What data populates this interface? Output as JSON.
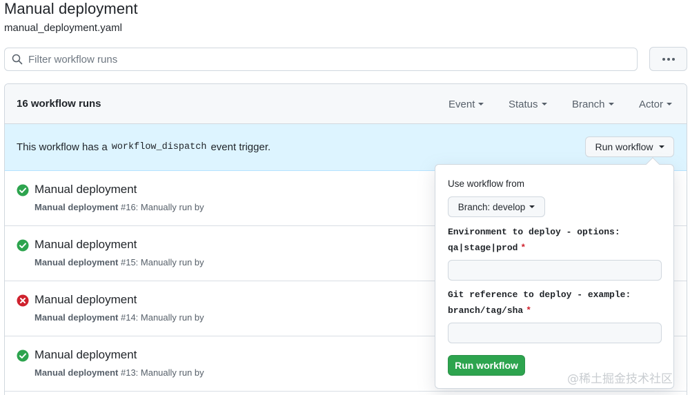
{
  "page": {
    "title": "Manual deployment",
    "subtitle": "manual_deployment.yaml"
  },
  "search": {
    "placeholder": "Filter workflow runs",
    "value": ""
  },
  "runs_header": {
    "count_label": "16 workflow runs",
    "filters": [
      "Event",
      "Status",
      "Branch",
      "Actor"
    ]
  },
  "dispatch_banner": {
    "text_before": "This workflow has a",
    "code": "workflow_dispatch",
    "text_after": "event trigger.",
    "button_label": "Run workflow"
  },
  "runs": [
    {
      "title": "Manual deployment",
      "workflow": "Manual deployment",
      "meta": "#16: Manually run by",
      "status": "success"
    },
    {
      "title": "Manual deployment",
      "workflow": "Manual deployment",
      "meta": "#15: Manually run by",
      "status": "success"
    },
    {
      "title": "Manual deployment",
      "workflow": "Manual deployment",
      "meta": "#14: Manually run by",
      "status": "failure"
    },
    {
      "title": "Manual deployment",
      "workflow": "Manual deployment",
      "meta": "#13: Manually run by",
      "status": "success"
    }
  ],
  "popover": {
    "use_from_label": "Use workflow from",
    "branch_label": "Branch: develop",
    "inputs": [
      {
        "label_line1": "Environment to deploy - options:",
        "label_line2": "qa|stage|prod",
        "required_mark": "*",
        "value": ""
      },
      {
        "label_line1": "Git reference to deploy - example:",
        "label_line2": "branch/tag/sha",
        "required_mark": "*",
        "value": ""
      }
    ],
    "submit_label": "Run workflow"
  },
  "watermark": "@稀土掘金技术社区",
  "colors": {
    "success": "#2da44e",
    "failure": "#cf222e",
    "banner_bg": "#ddf4ff",
    "header_bg": "#f6f8fa"
  }
}
